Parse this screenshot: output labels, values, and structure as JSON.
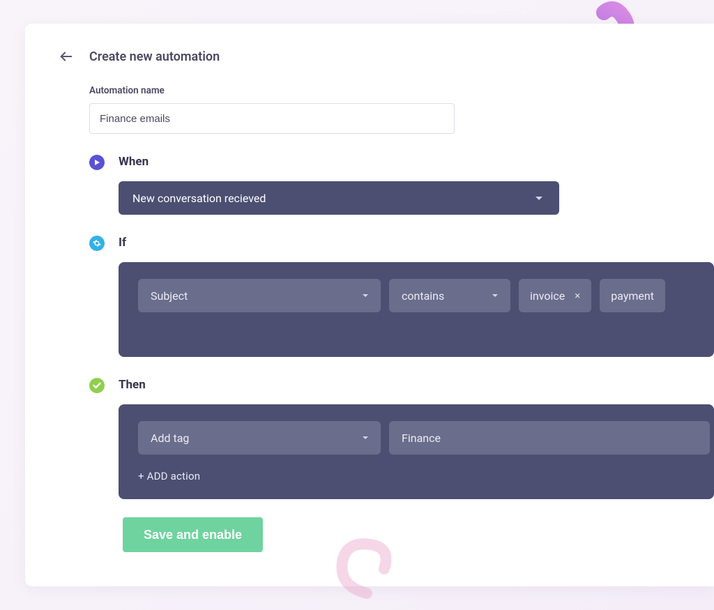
{
  "header": {
    "title": "Create new automation"
  },
  "name_field": {
    "label": "Automation name",
    "value": "Finance emails"
  },
  "when": {
    "heading": "When",
    "trigger": "New conversation recieved"
  },
  "if": {
    "heading": "If",
    "field": "Subject",
    "operator": "contains",
    "tags": [
      "invoice",
      "payment"
    ]
  },
  "then": {
    "heading": "Then",
    "action": "Add tag",
    "value": "Finance",
    "add_action": "+ ADD action"
  },
  "buttons": {
    "save": "Save and enable"
  },
  "colors": {
    "panel": "#4c4f72",
    "pill": "#6a6d8b",
    "accent_play": "#5952d6",
    "accent_gear": "#33b1e8",
    "accent_check": "#8fcf4e",
    "save": "#6fd39f"
  }
}
